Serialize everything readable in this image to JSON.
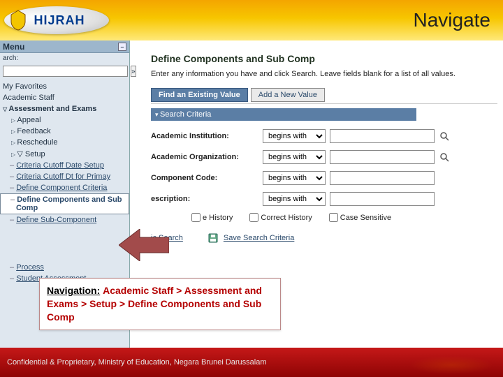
{
  "brand": {
    "name": "HIJRAH"
  },
  "header": {
    "navigate": "Navigate"
  },
  "menu": {
    "title": "Menu",
    "search_label": "arch:",
    "go": "»",
    "items": {
      "favorites": "My Favorites",
      "academic_staff": "Academic Staff",
      "assessment": "Assessment and Exams",
      "appeal": "Appeal",
      "feedback": "Feedback",
      "reschedule": "Reschedule",
      "setup": "Setup",
      "cc_date": "Criteria Cutoff Date Setup",
      "cc_primary": "Criteria Cutoff Dt for Primay",
      "def_comp_crit": "Define Component Criteria",
      "def_comp_sub": "Define Components and Sub Comp",
      "def_subcomp": "Define Sub-Component",
      "process": "Process",
      "student_assessment": "Student Assessment"
    }
  },
  "page": {
    "title": "Define Components and Sub Comp",
    "intro": "Enter any information you have and click Search. Leave fields blank for a list of all values.",
    "tabs": {
      "existing": "Find an Existing Value",
      "add": "Add a New Value"
    },
    "criteria_header": "Search Criteria",
    "fields": {
      "inst": "Academic Institution:",
      "org": "Academic Organization:",
      "code": "Component Code:",
      "desc": "escription:"
    },
    "op": "begins with",
    "checks": {
      "history": "e History",
      "correct": "Correct History",
      "case": "Case Sensitive"
    },
    "links": {
      "basic": "ic Search",
      "save": "Save Search Criteria"
    }
  },
  "callout": {
    "lead": "Navigation:",
    "path": "Academic Staff > Assessment and Exams > Setup > Define Components and Sub Comp"
  },
  "footer": {
    "text": "Confidential & Proprietary, Ministry of Education, Negara Brunei Darussalam"
  }
}
